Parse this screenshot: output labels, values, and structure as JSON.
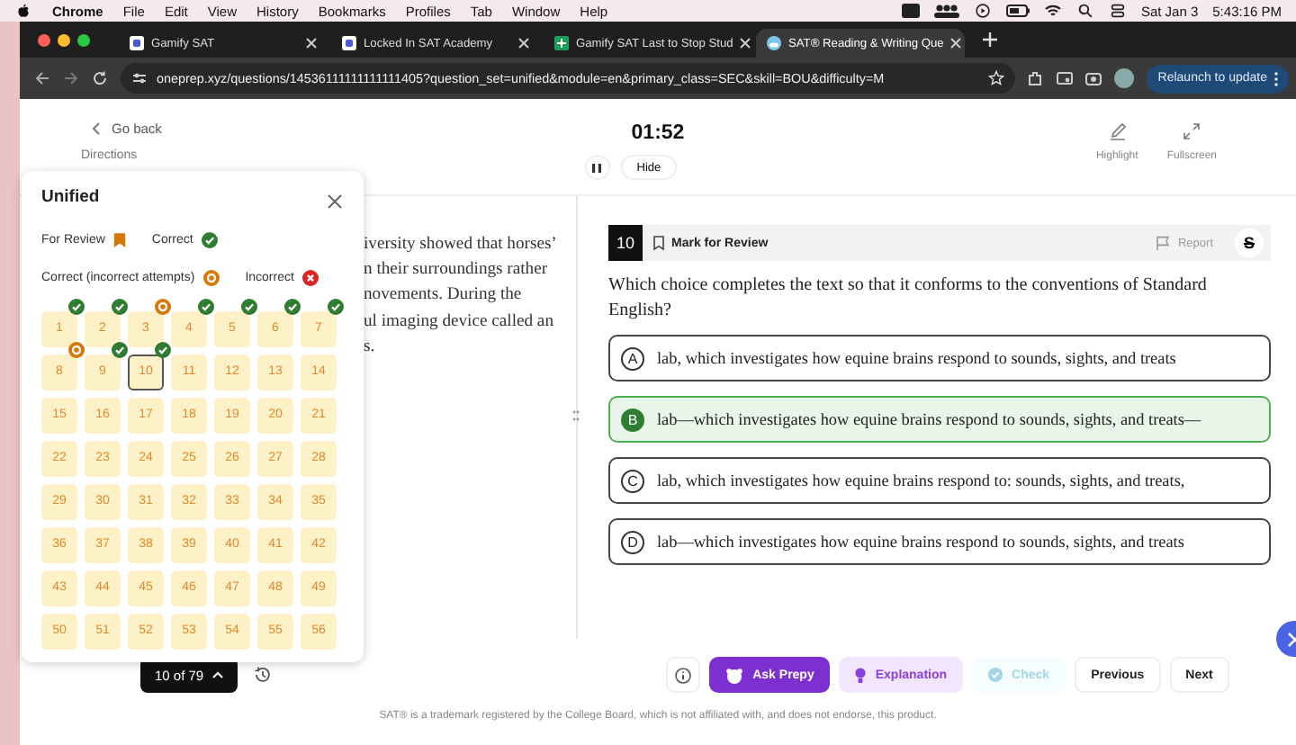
{
  "menu_bar": {
    "app": "Chrome",
    "items": [
      "File",
      "Edit",
      "View",
      "History",
      "Bookmarks",
      "Profiles",
      "Tab",
      "Window",
      "Help"
    ],
    "date": "Sat Jan 3",
    "time": "5:43:16 PM"
  },
  "browser_tabs": [
    {
      "title": "Gamify SAT",
      "kind": "app",
      "selected": false
    },
    {
      "title": "Locked In SAT Academy",
      "kind": "app",
      "selected": false
    },
    {
      "title": "Gamify SAT Last to Stop Stud",
      "kind": "sheet",
      "selected": false
    },
    {
      "title": "SAT® Reading & Writing Que",
      "kind": "globe",
      "selected": true
    }
  ],
  "address_bar": {
    "url": "oneprep.xyz/questions/14536111111111111405?question_set=unified&module=en&primary_class=SEC&skill=BOU&difficulty=M",
    "update_button": "Relaunch to update"
  },
  "header": {
    "back": "Go back",
    "directions": "Directions",
    "timer": "01:52",
    "hide": "Hide",
    "tools": [
      "Highlight",
      "Fullscreen"
    ]
  },
  "passage": [
    "iversity showed that horses’",
    "n their surroundings rather",
    "novements. During the",
    "ul imaging device called an",
    "s."
  ],
  "question_panel": {
    "title": "Unified",
    "legend": [
      {
        "label": "For Review",
        "kind": "review"
      },
      {
        "label": "Correct",
        "kind": "correct"
      },
      {
        "label": "Correct (incorrect attempts)",
        "kind": "attempts"
      },
      {
        "label": "Incorrect",
        "kind": "incorrect"
      }
    ],
    "cells": [
      {
        "label": "1",
        "kind": "correct",
        "selected": false
      },
      {
        "label": "2",
        "kind": "correct",
        "selected": false
      },
      {
        "label": "3",
        "kind": "attempts",
        "selected": false
      },
      {
        "label": "4",
        "kind": "correct",
        "selected": false
      },
      {
        "label": "5",
        "kind": "correct",
        "selected": false
      },
      {
        "label": "6",
        "kind": "correct",
        "selected": false
      },
      {
        "label": "7",
        "kind": "correct",
        "selected": false
      },
      {
        "label": "8",
        "kind": "attempts",
        "selected": false
      },
      {
        "label": "9",
        "kind": "correct",
        "selected": false
      },
      {
        "label": "10",
        "kind": "correct",
        "selected": true
      },
      {
        "label": "11",
        "kind": "none",
        "selected": false
      },
      {
        "label": "12",
        "kind": "none",
        "selected": false
      },
      {
        "label": "13",
        "kind": "none",
        "selected": false
      },
      {
        "label": "14",
        "kind": "none",
        "selected": false
      },
      {
        "label": "15",
        "kind": "none",
        "selected": false
      },
      {
        "label": "16",
        "kind": "none",
        "selected": false
      },
      {
        "label": "17",
        "kind": "none",
        "selected": false
      },
      {
        "label": "18",
        "kind": "none",
        "selected": false
      },
      {
        "label": "19",
        "kind": "none",
        "selected": false
      },
      {
        "label": "20",
        "kind": "none",
        "selected": false
      },
      {
        "label": "21",
        "kind": "none",
        "selected": false
      },
      {
        "label": "22",
        "kind": "none",
        "selected": false
      },
      {
        "label": "23",
        "kind": "none",
        "selected": false
      },
      {
        "label": "24",
        "kind": "none",
        "selected": false
      },
      {
        "label": "25",
        "kind": "none",
        "selected": false
      },
      {
        "label": "26",
        "kind": "none",
        "selected": false
      },
      {
        "label": "27",
        "kind": "none",
        "selected": false
      },
      {
        "label": "28",
        "kind": "none",
        "selected": false
      },
      {
        "label": "29",
        "kind": "none",
        "selected": false
      },
      {
        "label": "30",
        "kind": "none",
        "selected": false
      },
      {
        "label": "31",
        "kind": "none",
        "selected": false
      },
      {
        "label": "32",
        "kind": "none",
        "selected": false
      },
      {
        "label": "33",
        "kind": "none",
        "selected": false
      },
      {
        "label": "34",
        "kind": "none",
        "selected": false
      },
      {
        "label": "35",
        "kind": "none",
        "selected": false
      },
      {
        "label": "36",
        "kind": "none",
        "selected": false
      },
      {
        "label": "37",
        "kind": "none",
        "selected": false
      },
      {
        "label": "38",
        "kind": "none",
        "selected": false
      },
      {
        "label": "39",
        "kind": "none",
        "selected": false
      },
      {
        "label": "40",
        "kind": "none",
        "selected": false
      },
      {
        "label": "41",
        "kind": "none",
        "selected": false
      },
      {
        "label": "42",
        "kind": "none",
        "selected": false
      },
      {
        "label": "43",
        "kind": "none",
        "selected": false
      },
      {
        "label": "44",
        "kind": "none",
        "selected": false
      },
      {
        "label": "45",
        "kind": "none",
        "selected": false
      },
      {
        "label": "46",
        "kind": "none",
        "selected": false
      },
      {
        "label": "47",
        "kind": "none",
        "selected": false
      },
      {
        "label": "48",
        "kind": "none",
        "selected": false
      },
      {
        "label": "49",
        "kind": "none",
        "selected": false
      },
      {
        "label": "50",
        "kind": "none",
        "selected": false
      },
      {
        "label": "51",
        "kind": "none",
        "selected": false
      },
      {
        "label": "52",
        "kind": "none",
        "selected": false
      },
      {
        "label": "53",
        "kind": "none",
        "selected": false
      },
      {
        "label": "54",
        "kind": "none",
        "selected": false
      },
      {
        "label": "55",
        "kind": "none",
        "selected": false
      },
      {
        "label": "56",
        "kind": "none",
        "selected": false
      }
    ],
    "counter": "10 of 79"
  },
  "question": {
    "number": "10",
    "mark_for_review": "Mark for Review",
    "report": "Report",
    "strike_button": "S",
    "prompt": "Which choice completes the text so that it conforms to the conventions of Standard English?",
    "options": [
      {
        "letter": "A",
        "text": "lab, which investigates how equine brains respond to sounds, sights, and treats",
        "selected": false
      },
      {
        "letter": "B",
        "text": "lab—which investigates how equine brains respond to sounds, sights, and treats—",
        "selected": true
      },
      {
        "letter": "C",
        "text": "lab, which investigates how equine brains respond to: sounds, sights, and treats,",
        "selected": false
      },
      {
        "letter": "D",
        "text": "lab—which investigates how equine brains respond to sounds, sights, and treats",
        "selected": false
      }
    ]
  },
  "actions": [
    {
      "label": "Ask Prepy",
      "kind": "ai",
      "disabled": false
    },
    {
      "label": "Explanation",
      "kind": "hint",
      "disabled": false
    },
    {
      "label": "Check",
      "kind": "check",
      "disabled": true
    },
    {
      "label": "Previous",
      "kind": "plain",
      "disabled": false
    },
    {
      "label": "Next",
      "kind": "plain",
      "disabled": false
    }
  ],
  "footer": "SAT® is a trademark registered by the College Board, which is not affiliated with, and does not endorse, this product."
}
